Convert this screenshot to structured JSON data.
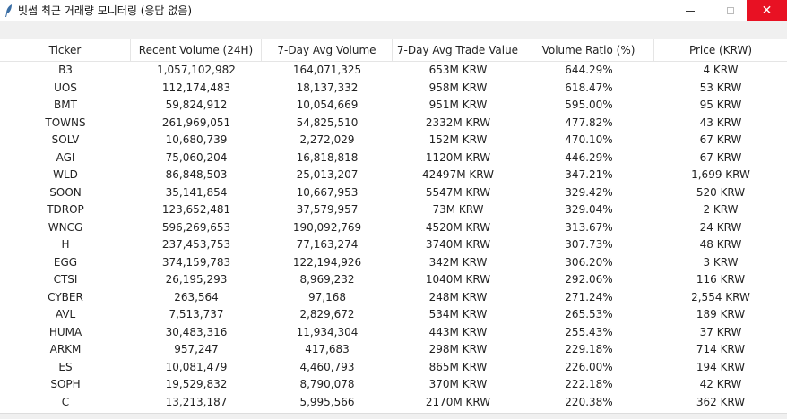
{
  "window": {
    "title": "빗썸 최근 거래량 모니터링 (응답 없음)",
    "close_color": "#e81123",
    "icons": {
      "app": "feather-icon",
      "minimize": "minimize-icon",
      "maximize": "maximize-icon",
      "close": "close-icon"
    },
    "close_glyph": "✕"
  },
  "table": {
    "columns": [
      "Ticker",
      "Recent Volume (24H)",
      "7-Day Avg Volume",
      "7-Day Avg Trade Value",
      "Volume Ratio (%)",
      "Price (KRW)"
    ],
    "rows": [
      [
        "B3",
        "1,057,102,982",
        "164,071,325",
        "653M KRW",
        "644.29%",
        "4 KRW"
      ],
      [
        "UOS",
        "112,174,483",
        "18,137,332",
        "958M KRW",
        "618.47%",
        "53 KRW"
      ],
      [
        "BMT",
        "59,824,912",
        "10,054,669",
        "951M KRW",
        "595.00%",
        "95 KRW"
      ],
      [
        "TOWNS",
        "261,969,051",
        "54,825,510",
        "2332M KRW",
        "477.82%",
        "43 KRW"
      ],
      [
        "SOLV",
        "10,680,739",
        "2,272,029",
        "152M KRW",
        "470.10%",
        "67 KRW"
      ],
      [
        "AGI",
        "75,060,204",
        "16,818,818",
        "1120M KRW",
        "446.29%",
        "67 KRW"
      ],
      [
        "WLD",
        "86,848,503",
        "25,013,207",
        "42497M KRW",
        "347.21%",
        "1,699 KRW"
      ],
      [
        "SOON",
        "35,141,854",
        "10,667,953",
        "5547M KRW",
        "329.42%",
        "520 KRW"
      ],
      [
        "TDROP",
        "123,652,481",
        "37,579,957",
        "73M KRW",
        "329.04%",
        "2 KRW"
      ],
      [
        "WNCG",
        "596,269,653",
        "190,092,769",
        "4520M KRW",
        "313.67%",
        "24 KRW"
      ],
      [
        "H",
        "237,453,753",
        "77,163,274",
        "3740M KRW",
        "307.73%",
        "48 KRW"
      ],
      [
        "EGG",
        "374,159,783",
        "122,194,926",
        "342M KRW",
        "306.20%",
        "3 KRW"
      ],
      [
        "CTSI",
        "26,195,293",
        "8,969,232",
        "1040M KRW",
        "292.06%",
        "116 KRW"
      ],
      [
        "CYBER",
        "263,564",
        "97,168",
        "248M KRW",
        "271.24%",
        "2,554 KRW"
      ],
      [
        "AVL",
        "7,513,737",
        "2,829,672",
        "534M KRW",
        "265.53%",
        "189 KRW"
      ],
      [
        "HUMA",
        "30,483,316",
        "11,934,304",
        "443M KRW",
        "255.43%",
        "37 KRW"
      ],
      [
        "ARKM",
        "957,247",
        "417,683",
        "298M KRW",
        "229.18%",
        "714 KRW"
      ],
      [
        "ES",
        "10,081,479",
        "4,460,793",
        "865M KRW",
        "226.00%",
        "194 KRW"
      ],
      [
        "SOPH",
        "19,529,832",
        "8,790,078",
        "370M KRW",
        "222.18%",
        "42 KRW"
      ],
      [
        "C",
        "13,213,187",
        "5,995,566",
        "2170M KRW",
        "220.38%",
        "362 KRW"
      ]
    ]
  }
}
